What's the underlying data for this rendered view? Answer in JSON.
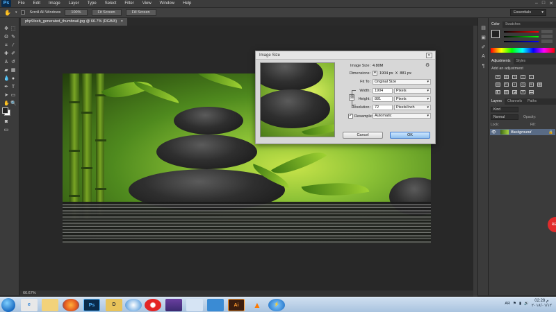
{
  "menu": {
    "items": [
      "File",
      "Edit",
      "Image",
      "Layer",
      "Type",
      "Select",
      "Filter",
      "View",
      "Window",
      "Help"
    ]
  },
  "options": {
    "scroll_all": "Scroll All Windows",
    "btn_100": "100%",
    "btn_fit": "Fit Screen",
    "btn_fill": "Fill Screen",
    "workspace": "Essentials"
  },
  "document": {
    "tab_title": "php9Ixeb_generated_thumbnail.jpg @ 66.7% (RGB/8)",
    "tab_close": "×",
    "zoom": "66.67%"
  },
  "panels": {
    "color_tab": "Color",
    "swatches_tab": "Swatches",
    "adjustments_tab": "Adjustments",
    "styles_tab": "Styles",
    "add_adjustment": "Add an adjustment",
    "layers_tab": "Layers",
    "channels_tab": "Channels",
    "paths_tab": "Paths",
    "kind": "Kind",
    "blend_mode": "Normal",
    "opacity_label": "Opacity:",
    "lock_label": "Lock:",
    "fill_label": "Fill:",
    "layer_name": "Background"
  },
  "dialog": {
    "title": "Image Size",
    "image_size_label": "Image Size:",
    "image_size_value": "4.80M",
    "dimensions_label": "Dimensions:",
    "dimensions_value": "1904 px  X  881 px",
    "fit_to_label": "Fit To:",
    "fit_to_value": "Original Size",
    "width_label": "Width:",
    "width_value": "1904",
    "width_unit": "Pixels",
    "height_label": "Height:",
    "height_value": "881",
    "height_unit": "Pixels",
    "resolution_label": "Resolution:",
    "resolution_value": "72",
    "resolution_unit": "Pixels/Inch",
    "resample_label": "Resample:",
    "resample_value": "Automatic",
    "cancel": "Cancel",
    "ok": "OK"
  },
  "taskbar": {
    "apps": [
      "Ps",
      "D",
      "Ai"
    ],
    "tray_lang": "AR",
    "clock_time": "02:28 م",
    "clock_date": "٢٠١٨/٠١/١٢"
  },
  "record_button": "REC",
  "colors": {
    "dialog_primary": "#8fc0ee",
    "layer_selected": "#596b85"
  }
}
